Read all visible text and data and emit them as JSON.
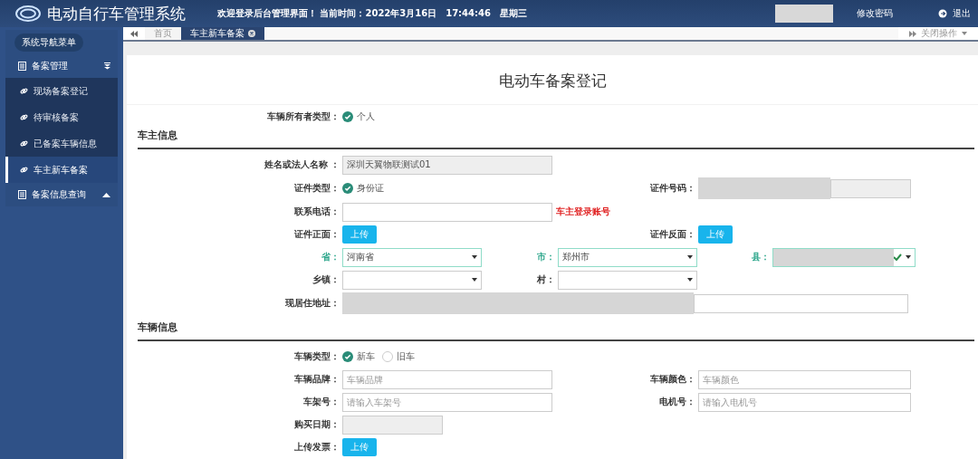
{
  "header": {
    "title": "电动自行车管理系统",
    "welcome": "欢迎登录后台管理界面！ 当前时间：2022年3月16日　17:44:46　星期三",
    "change_password": "修改密码",
    "logout": "退出"
  },
  "sidebar": {
    "heading": "系统导航菜单",
    "groups": [
      {
        "label": "备案管理",
        "expanded": true,
        "children": [
          {
            "label": "现场备案登记",
            "selected": false
          },
          {
            "label": "待审核备案",
            "selected": false
          },
          {
            "label": "已备案车辆信息",
            "selected": false
          },
          {
            "label": "车主新车备案",
            "selected": true
          }
        ]
      },
      {
        "label": "备案信息查询",
        "expanded": false
      }
    ]
  },
  "tabs": [
    {
      "label": "首页",
      "selected": false,
      "closable": false
    },
    {
      "label": "车主新车备案",
      "selected": true,
      "closable": true
    }
  ],
  "close_menu": "关闭操作",
  "form": {
    "title": "电动车备案登记",
    "owner_type": {
      "label": "车辆所有者类型：",
      "options": [
        {
          "label": "个人",
          "selected": true
        }
      ]
    },
    "sections": [
      {
        "heading": "车主信息",
        "rows": [
          {
            "kind": "pair",
            "fields": [
              {
                "kind": "text",
                "label": "姓名或法人名称 ：",
                "value": "深圳天翼物联测试01",
                "disabled": true
              }
            ]
          },
          {
            "kind": "pair",
            "fields": [
              {
                "kind": "radio",
                "label": "证件类型：",
                "options": [
                  {
                    "label": "身份证",
                    "selected": true
                  }
                ]
              },
              {
                "kind": "text",
                "label": "证件号码：",
                "disabled": true,
                "redacted": true
              }
            ]
          },
          {
            "kind": "pair",
            "fields": [
              {
                "kind": "text",
                "label": "联系电话：",
                "disabled": false,
                "hint": "车主登录账号"
              }
            ]
          },
          {
            "kind": "pair",
            "fields": [
              {
                "kind": "upload",
                "label": "证件正面：",
                "button": "上传"
              },
              {
                "kind": "upload",
                "label": "证件反面：",
                "button": "上传"
              }
            ]
          },
          {
            "kind": "triple",
            "fields": [
              {
                "kind": "select",
                "label": "省：",
                "value": "河南省",
                "valid": true
              },
              {
                "kind": "select",
                "label": "市：",
                "value": "郑州市",
                "valid": true
              },
              {
                "kind": "select",
                "label": "县：",
                "valid": true,
                "redacted": true
              }
            ]
          },
          {
            "kind": "triple",
            "fields": [
              {
                "kind": "select",
                "label": "乡镇：",
                "valid": false
              },
              {
                "kind": "select",
                "label": "村：",
                "valid": false
              }
            ]
          },
          {
            "kind": "wide",
            "fields": [
              {
                "kind": "text",
                "label": "现居住地址：",
                "disabled": false,
                "redacted": true
              }
            ]
          }
        ]
      },
      {
        "heading": "车辆信息",
        "rows": [
          {
            "kind": "pair",
            "fields": [
              {
                "kind": "radio",
                "label": "车辆类型：",
                "options": [
                  {
                    "label": "新车",
                    "selected": true
                  },
                  {
                    "label": "旧车",
                    "selected": false
                  }
                ]
              }
            ]
          },
          {
            "kind": "pair",
            "fields": [
              {
                "kind": "text",
                "label": "车辆品牌：",
                "placeholder": "车辆品牌",
                "disabled": false
              },
              {
                "kind": "text",
                "label": "车辆颜色：",
                "placeholder": "车辆颜色",
                "disabled": false
              }
            ]
          },
          {
            "kind": "pair",
            "fields": [
              {
                "kind": "text",
                "label": "车架号：",
                "placeholder": "请输入车架号",
                "disabled": false
              },
              {
                "kind": "text",
                "label": "电机号：",
                "placeholder": "请输入电机号",
                "disabled": false
              }
            ]
          },
          {
            "kind": "short",
            "fields": [
              {
                "kind": "text",
                "label": "购买日期：",
                "disabled": true
              }
            ]
          },
          {
            "kind": "pair",
            "fields": [
              {
                "kind": "upload",
                "label": "上传发票：",
                "button": "上传"
              }
            ]
          }
        ]
      }
    ]
  }
}
